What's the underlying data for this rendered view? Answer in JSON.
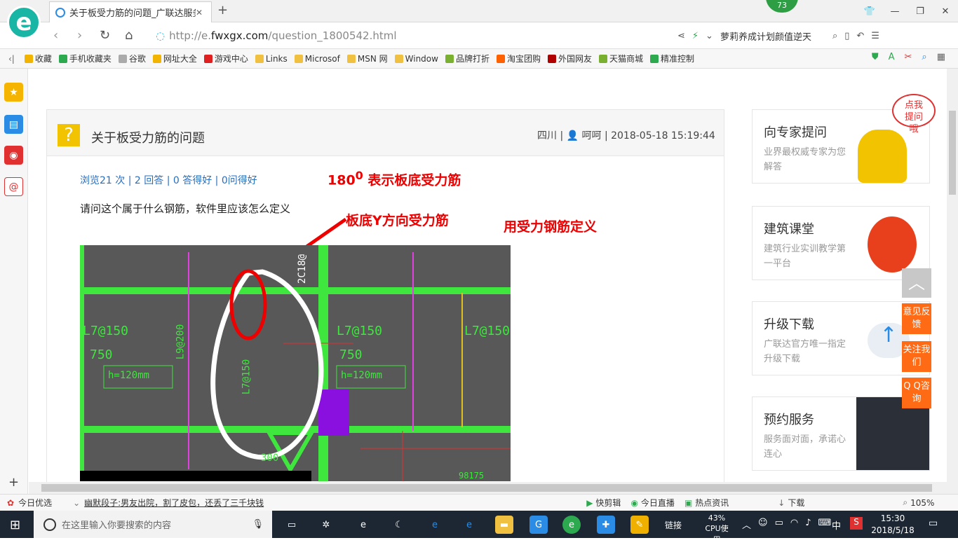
{
  "browser": {
    "tab_title": "关于板受力筋的问题_广联达服务",
    "badge": "73",
    "url_prefix": "http://e.",
    "url_domain": "fwxgx.com",
    "url_path": "/question_1800542.html",
    "search_text": "萝莉养成计划颜值逆天"
  },
  "bookmarks": [
    {
      "label": "收藏",
      "color": "#f2b400"
    },
    {
      "label": "手机收藏夹",
      "color": "#2da94f"
    },
    {
      "label": "谷歌",
      "color": "#aaaaaa"
    },
    {
      "label": "网址大全",
      "color": "#f2b400"
    },
    {
      "label": "游戏中心",
      "color": "#e02020"
    },
    {
      "label": "Links",
      "color": "#f0c040"
    },
    {
      "label": "Microsof",
      "color": "#f0c040"
    },
    {
      "label": "MSN 网",
      "color": "#f0c040"
    },
    {
      "label": "Window",
      "color": "#f0c040"
    },
    {
      "label": "品牌打折",
      "color": "#7ab030"
    },
    {
      "label": "淘宝团购",
      "color": "#ff6000"
    },
    {
      "label": "外国网友",
      "color": "#b00000"
    },
    {
      "label": "天猫商城",
      "color": "#7ab030"
    },
    {
      "label": "精准控制",
      "color": "#2da94f"
    }
  ],
  "question": {
    "title": "关于板受力筋的问题",
    "meta": "四川 | 👤 呵呵 | 2018-05-18 15:19:44",
    "stats": "浏览21 次 | 2 回答 | 0 答得好 | 0问得好",
    "body": "请问这个属于什么钢筋，软件里应该怎么定义"
  },
  "annotations": {
    "a1_main": "180",
    "a1_sup": "0",
    "a1_rest": " 表示板底受力筋",
    "a2": "板底Y方向受力筋",
    "a3": "用受力钢筋定义"
  },
  "cad": {
    "t1": "L7@150",
    "t2": "750",
    "t3": "h=120mm",
    "t4": "L9@200",
    "t5": "L7@150",
    "t6": "L7@150",
    "t7": "750",
    "t8": "h=120mm",
    "t9": "L7@150",
    "t10": "2C18@",
    "t11": "300",
    "t12": "98175"
  },
  "sidebar": [
    {
      "title": "向专家提问",
      "desc": "业界最权威专家为您解答"
    },
    {
      "title": "建筑课堂",
      "desc": "建筑行业实训教学第一平台"
    },
    {
      "title": "升级下载",
      "desc": "广联达官方唯一指定升级下载"
    },
    {
      "title": "预约服务",
      "desc": "服务面对面，承诺心连心"
    }
  ],
  "bubble": "点我提问哦",
  "float_buttons": [
    "意见反馈",
    "关注我们",
    "Q Q咨询"
  ],
  "statusbar": {
    "today": "今日优选",
    "news": "幽默段子:男友出院，割了皮包，还丢了三千块钱",
    "s1": "快剪辑",
    "s2": "今日直播",
    "s3": "热点资讯",
    "s4": "下载",
    "zoom": "105%"
  },
  "taskbar": {
    "search_placeholder": "在这里输入你要搜索的内容",
    "links": "链接",
    "cpu_pct": "43%",
    "cpu_label": "CPU使用",
    "ime": "中",
    "time": "15:30",
    "date": "2018/5/18"
  }
}
